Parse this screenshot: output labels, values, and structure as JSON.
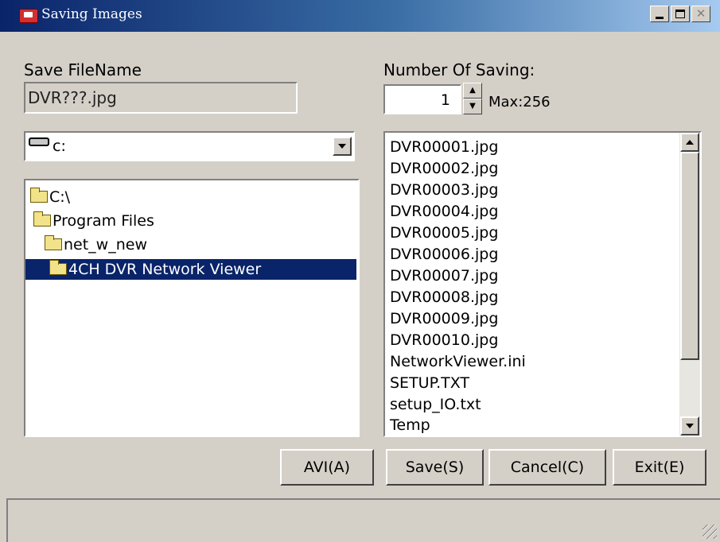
{
  "window": {
    "title": "Saving Images",
    "close_glyph": "✕"
  },
  "save": {
    "label": "Save FileName",
    "value": "DVR???.jpg"
  },
  "count": {
    "label": "Number Of Saving:",
    "value": "1",
    "max": "Max:256"
  },
  "drive": {
    "value": "c:"
  },
  "tree": {
    "items": [
      {
        "label": "C:\\",
        "icon": "folder-open-icon"
      },
      {
        "label": "Program Files",
        "icon": "folder-open-icon"
      },
      {
        "label": "net_w_new",
        "icon": "folder-open-icon"
      },
      {
        "label": "4CH DVR Network Viewer",
        "icon": "folder-open-icon",
        "selected": true
      }
    ]
  },
  "files": [
    "DVR00001.jpg",
    "DVR00002.jpg",
    "DVR00003.jpg",
    "DVR00004.jpg",
    "DVR00005.jpg",
    "DVR00006.jpg",
    "DVR00007.jpg",
    "DVR00008.jpg",
    "DVR00009.jpg",
    "DVR00010.jpg",
    "NetworkViewer.ini",
    "SETUP.TXT",
    "setup_IO.txt",
    "Temp"
  ],
  "buttons": {
    "avi": "AVI(A)",
    "save": "Save(S)",
    "cancel": "Cancel(C)",
    "exit": "Exit(E)"
  },
  "colors": {
    "title_bar": "#0a246a",
    "face": "#d4d0c8",
    "selection": "#0a246a"
  }
}
